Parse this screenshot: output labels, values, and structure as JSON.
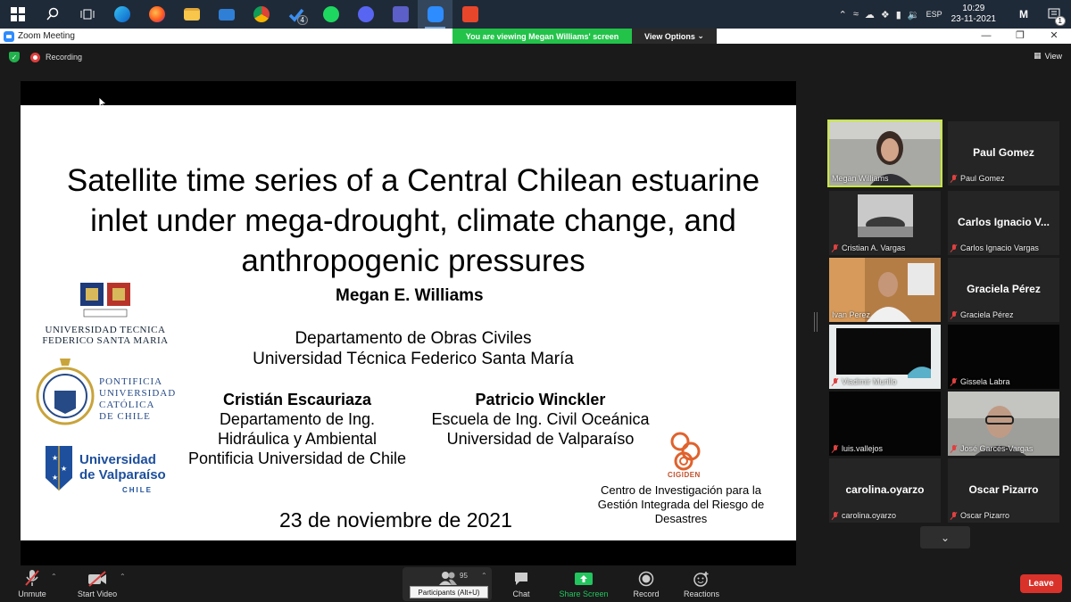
{
  "taskbar": {
    "icons": [
      "windows-start",
      "search",
      "task-view",
      "edge",
      "firefox",
      "file-explorer",
      "mail",
      "chrome",
      "todo",
      "spotify",
      "discord",
      "teams",
      "zoom",
      "office"
    ],
    "todo_badge": "4",
    "language": "ESP",
    "time": "10:29",
    "date": "23-11-2021",
    "notification_count": "1"
  },
  "window": {
    "title": "Zoom Meeting",
    "viewing_banner": "You are viewing Megan Williams' screen",
    "view_options": "View Options"
  },
  "meeting": {
    "recording_label": "Recording",
    "view_label": "View"
  },
  "slide": {
    "title": "Satellite time series of a Central Chilean estuarine inlet under mega-drought, climate change, and anthropogenic pressures",
    "author": "Megan E. Williams",
    "affiliation_line1": "Departamento de Obras Civiles",
    "affiliation_line2": "Universidad Técnica Federico Santa María",
    "coauthor1": {
      "name": "Cristián Escauriaza",
      "line1": "Departamento de Ing.",
      "line2": "Hidráulica y Ambiental",
      "line3": "Pontificia Universidad de Chile"
    },
    "coauthor2": {
      "name": "Patricio Winckler",
      "line1": "Escuela de Ing. Civil Oceánica",
      "line2": "Universidad de Valparaíso"
    },
    "date": "23 de noviembre de 2021",
    "cigiden_label": "CIGIDEN",
    "cigiden_text": "Centro de Investigación para la Gestión Integrada del Riesgo de Desastres",
    "logo_utfsm_line1": "UNIVERSIDAD TECNICA",
    "logo_utfsm_line2": "FEDERICO SANTA MARIA",
    "logo_puc_lines": [
      "PONTIFICIA",
      "UNIVERSIDAD",
      "CATÓLICA",
      "DE CHILE"
    ],
    "logo_uv_line1": "Universidad",
    "logo_uv_line2": "de Valparaíso",
    "logo_uv_line3": "CHILE"
  },
  "participants": [
    {
      "name": "Megan Williams",
      "display": "",
      "video": true,
      "muted": false
    },
    {
      "name": "Paul Gomez",
      "display": "Paul Gomez",
      "video": false,
      "muted": true
    },
    {
      "name": "Cristian A. Vargas",
      "display": "",
      "video": true,
      "muted": true
    },
    {
      "name": "Carlos Ignacio Vargas",
      "display": "Carlos Ignacio V...",
      "video": false,
      "muted": true
    },
    {
      "name": "Ivan Perez",
      "display": "",
      "video": true,
      "muted": false
    },
    {
      "name": "Graciela Pérez",
      "display": "Graciela Pérez",
      "video": false,
      "muted": true
    },
    {
      "name": "Vladimir Murillo",
      "display": "",
      "video": true,
      "muted": true
    },
    {
      "name": "Gissela Labra",
      "display": "",
      "video": false,
      "muted": true
    },
    {
      "name": "luis.vallejos",
      "display": "",
      "video": false,
      "muted": true
    },
    {
      "name": "José Garcés-Vargas",
      "display": "",
      "video": true,
      "muted": true
    },
    {
      "name": "carolina.oyarzo",
      "display": "carolina.oyarzo",
      "video": false,
      "muted": true
    },
    {
      "name": "Oscar Pizarro",
      "display": "Oscar Pizarro",
      "video": false,
      "muted": true
    }
  ],
  "toolbar": {
    "unmute": "Unmute",
    "start_video": "Start Video",
    "participants_count": "95",
    "participants_tooltip": "Participants (Alt+U)",
    "chat": "Chat",
    "share_screen": "Share Screen",
    "record": "Record",
    "reactions": "Reactions",
    "leave": "Leave"
  }
}
